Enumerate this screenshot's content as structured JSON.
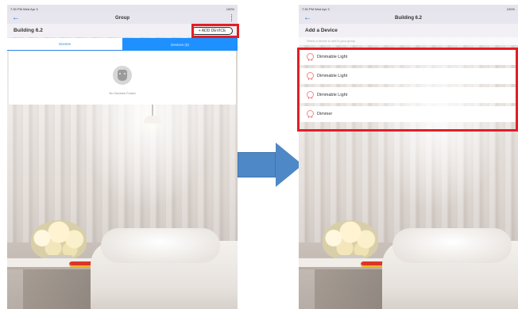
{
  "left": {
    "status_time": "7:30 PM  Wed Apr 3",
    "status_battery": "100%",
    "nav_title": "Group",
    "heading": "Building 6.2",
    "add_device_label": "+ ADD DEVICE",
    "tabs": [
      {
        "label": "Scenes",
        "active": false
      },
      {
        "label": "Devices (0)",
        "active": true
      }
    ],
    "empty_message": "No Devices Found"
  },
  "right": {
    "status_time": "7:30 PM  Wed Apr 3",
    "status_battery": "100%",
    "nav_title": "Building 6.2",
    "heading": "Add a Device",
    "subtitle": "Select a device to add to your group",
    "devices": [
      {
        "label": "Dimmable Light",
        "icon": "bulb-icon"
      },
      {
        "label": "Dimmable Light",
        "icon": "bulb-icon"
      },
      {
        "label": "Dimmable Light",
        "icon": "bulb-icon"
      },
      {
        "label": "Dimmer",
        "icon": "bulb-icon"
      }
    ]
  },
  "colors": {
    "accent_blue": "#1e90ff",
    "highlight_red": "#e31e24",
    "arrow_blue": "#4f88c6"
  }
}
